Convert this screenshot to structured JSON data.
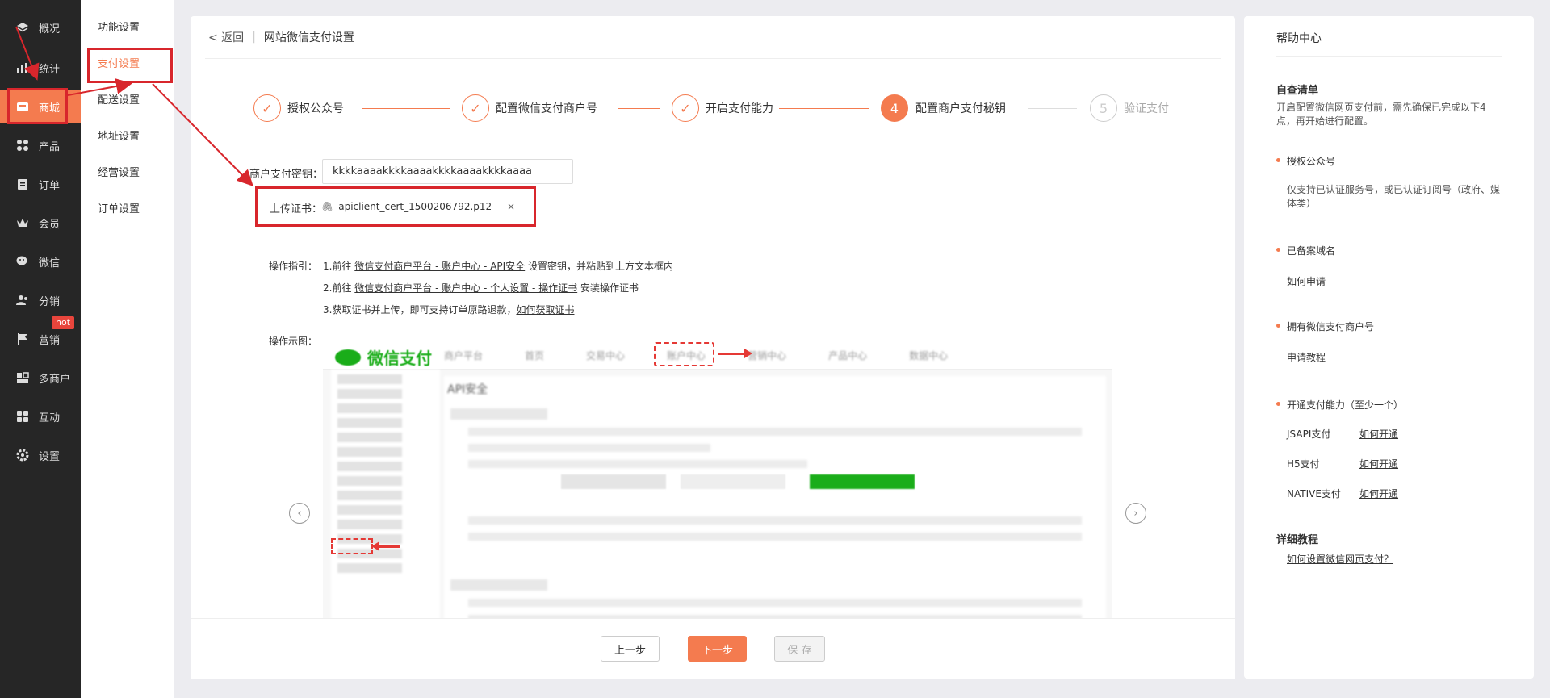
{
  "sidebar": {
    "items": [
      {
        "label": "概况",
        "icon": "layers-icon"
      },
      {
        "label": "统计",
        "icon": "bar-chart-icon"
      },
      {
        "label": "商城",
        "icon": "shop-icon"
      },
      {
        "label": "产品",
        "icon": "grid-icon"
      },
      {
        "label": "订单",
        "icon": "clipboard-icon"
      },
      {
        "label": "会员",
        "icon": "crown-icon"
      },
      {
        "label": "微信",
        "icon": "wechat-icon"
      },
      {
        "label": "分销",
        "icon": "people-icon"
      },
      {
        "label": "营销",
        "icon": "flag-icon"
      },
      {
        "label": "多商户",
        "icon": "store-icon"
      },
      {
        "label": "互动",
        "icon": "interact-icon"
      },
      {
        "label": "设置",
        "icon": "gear-icon"
      }
    ],
    "active": "商城",
    "hot_badge": "hot"
  },
  "subnav": {
    "items": [
      "功能设置",
      "支付设置",
      "配送设置",
      "地址设置",
      "经营设置",
      "订单设置"
    ],
    "active": "支付设置"
  },
  "breadcrumb": {
    "back": "< 返回",
    "title": "网站微信支付设置"
  },
  "steps": [
    {
      "label": "授权公众号",
      "status": "done"
    },
    {
      "label": "配置微信支付商户号",
      "status": "done"
    },
    {
      "label": "开启支付能力",
      "status": "done"
    },
    {
      "label": "配置商户支付秘钥",
      "status": "current",
      "number": "4"
    },
    {
      "label": "验证支付",
      "status": "todo",
      "number": "5"
    }
  ],
  "form": {
    "secret_label": "商户支付密钥：",
    "secret_value": "kkkkaaaakkkkaaaakkkkaaaakkkkaaaa",
    "upload_label": "上传证书：",
    "upload_file": "apiclient_cert_1500206792.p12"
  },
  "guide": {
    "label": "操作指引：",
    "step1_prefix": "1.前往",
    "step1_link": "微信支付商户平台 - 账户中心 - API安全",
    "step1_suffix": "设置密钥，并粘贴到上方文本框内",
    "step2_prefix": "2.前往",
    "step2_link": "微信支付商户平台 - 账户中心 - 个人设置 - 操作证书",
    "step2_suffix": "安装操作证书",
    "step3_text": "3.获取证书并上传，即可支持订单原路退款，",
    "step3_link": "如何获取证书"
  },
  "demo": {
    "label": "操作示图：",
    "logo_text": "微信支付",
    "tabs": [
      "商户平台",
      "首页",
      "交易中心",
      "账户中心",
      "营销中心",
      "产品中心",
      "数据中心"
    ],
    "section_title": "API安全"
  },
  "footer": {
    "prev": "上一步",
    "next": "下一步",
    "save": "保 存"
  },
  "help": {
    "title": "帮助中心",
    "checklist_title": "自查清单",
    "checklist_intro": "开启配置微信网页支付前，需先确保已完成以下4点，再开始进行配置。",
    "item1_title": "授权公众号",
    "item1_desc": "仅支持已认证服务号，或已认证订阅号（政府、媒体类）",
    "item2_title": "已备案域名",
    "item2_link": "如何申请",
    "item3_title": "拥有微信支付商户号",
    "item3_link": "申请教程",
    "item4_title": "开通支付能力（至少一个）",
    "pay_types": [
      {
        "name": "JSAPI支付",
        "link": "如何开通"
      },
      {
        "name": "H5支付",
        "link": "如何开通"
      },
      {
        "name": "NATIVE支付",
        "link": "如何开通"
      }
    ],
    "tutorial_title": "详细教程",
    "tutorial_link": "如何设置微信网页支付？"
  },
  "colors": {
    "accent": "#f47b4f",
    "sidebar_bg": "#262626",
    "annotation": "#d8262c",
    "wechat_green": "#1aad19"
  }
}
